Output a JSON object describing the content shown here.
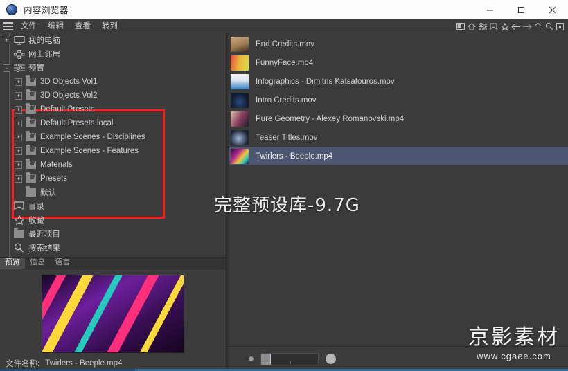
{
  "window": {
    "title": "内容浏览器",
    "app_icon": "sphere-icon",
    "controls": {
      "minimize": "minimize-icon",
      "maximize": "maximize-icon",
      "close": "close-icon"
    }
  },
  "menubar": {
    "hamburger": "hamburger-icon",
    "items": [
      "文件",
      "编辑",
      "查看",
      "转到"
    ],
    "toolbar_icons": [
      "panel-icon",
      "home-icon",
      "filter-sliders-icon",
      "bookmark-icon",
      "star-icon",
      "back-arrow-icon",
      "forward-arrow-icon",
      "up-arrow-icon",
      "search-icon",
      "center-box-icon"
    ]
  },
  "tree": {
    "items": [
      {
        "label": "我的电脑",
        "icon": "monitor-icon",
        "depth": 0,
        "expander": "+",
        "locked": false
      },
      {
        "label": "网上邻居",
        "icon": "network-icon",
        "depth": 0,
        "expander": "",
        "locked": false
      },
      {
        "label": "预置",
        "icon": "sliders-icon",
        "depth": 0,
        "expander": "-",
        "locked": false
      },
      {
        "label": "3D Objects Vol1",
        "icon": "folder-locked-icon",
        "depth": 1,
        "expander": "+",
        "locked": true
      },
      {
        "label": "3D Objects Vol2",
        "icon": "folder-locked-icon",
        "depth": 1,
        "expander": "+",
        "locked": true
      },
      {
        "label": "Default Presets",
        "icon": "folder-locked-icon",
        "depth": 1,
        "expander": "+",
        "locked": true
      },
      {
        "label": "Default Presets.local",
        "icon": "folder-locked-icon",
        "depth": 1,
        "expander": "+",
        "locked": true
      },
      {
        "label": "Example Scenes - Disciplines",
        "icon": "folder-locked-icon",
        "depth": 1,
        "expander": "+",
        "locked": true
      },
      {
        "label": "Example Scenes - Features",
        "icon": "folder-locked-icon",
        "depth": 1,
        "expander": "+",
        "locked": true
      },
      {
        "label": "Materials",
        "icon": "folder-locked-icon",
        "depth": 1,
        "expander": "+",
        "locked": true
      },
      {
        "label": "Presets",
        "icon": "folder-locked-icon",
        "depth": 1,
        "expander": "+",
        "locked": true
      },
      {
        "label": "默认",
        "icon": "folder-icon",
        "depth": 1,
        "expander": "",
        "locked": false
      },
      {
        "label": "目录",
        "icon": "catalog-icon",
        "depth": 0,
        "expander": "",
        "locked": false
      },
      {
        "label": "收藏",
        "icon": "star-icon",
        "depth": 0,
        "expander": "",
        "locked": false
      },
      {
        "label": "最近项目",
        "icon": "folder-icon",
        "depth": 0,
        "expander": "",
        "locked": false
      },
      {
        "label": "搜索结果",
        "icon": "search-icon",
        "depth": 0,
        "expander": "",
        "locked": false
      }
    ],
    "highlight_color": "#fb2020"
  },
  "overlay": {
    "text": "完整预设库-9.7G"
  },
  "filelist": {
    "selected_index": 6,
    "selection_color": "#4d5670",
    "rows": [
      {
        "name": "End Credits.mov",
        "thumb": "art-end"
      },
      {
        "name": "FunnyFace.mp4",
        "thumb": "art-funny"
      },
      {
        "name": "Infographics - Dimitris Katsafouros.mov",
        "thumb": "art-info"
      },
      {
        "name": "Intro Credits.mov",
        "thumb": "art-intro"
      },
      {
        "name": "Pure Geometry - Alexey Romanovski.mp4",
        "thumb": "art-pure"
      },
      {
        "name": "Teaser Titles.mov",
        "thumb": "art-teaser"
      },
      {
        "name": "Twirlers - Beeple.mp4",
        "thumb": "art-twirl"
      }
    ]
  },
  "zoombar": {
    "small_dot": "small-thumbnail-size-icon",
    "large_circle": "large-thumbnail-size-icon",
    "slider": "thumbnail-size-slider"
  },
  "preview": {
    "tabs": [
      {
        "label": "预览",
        "active": true
      },
      {
        "label": "信息",
        "active": false
      },
      {
        "label": "语言",
        "active": false
      }
    ],
    "filename_label": "文件名称:",
    "filename_value": "Twirlers - Beeple.mp4"
  },
  "watermark": {
    "main": "京影素材",
    "sub": "www.cgaee.com"
  }
}
